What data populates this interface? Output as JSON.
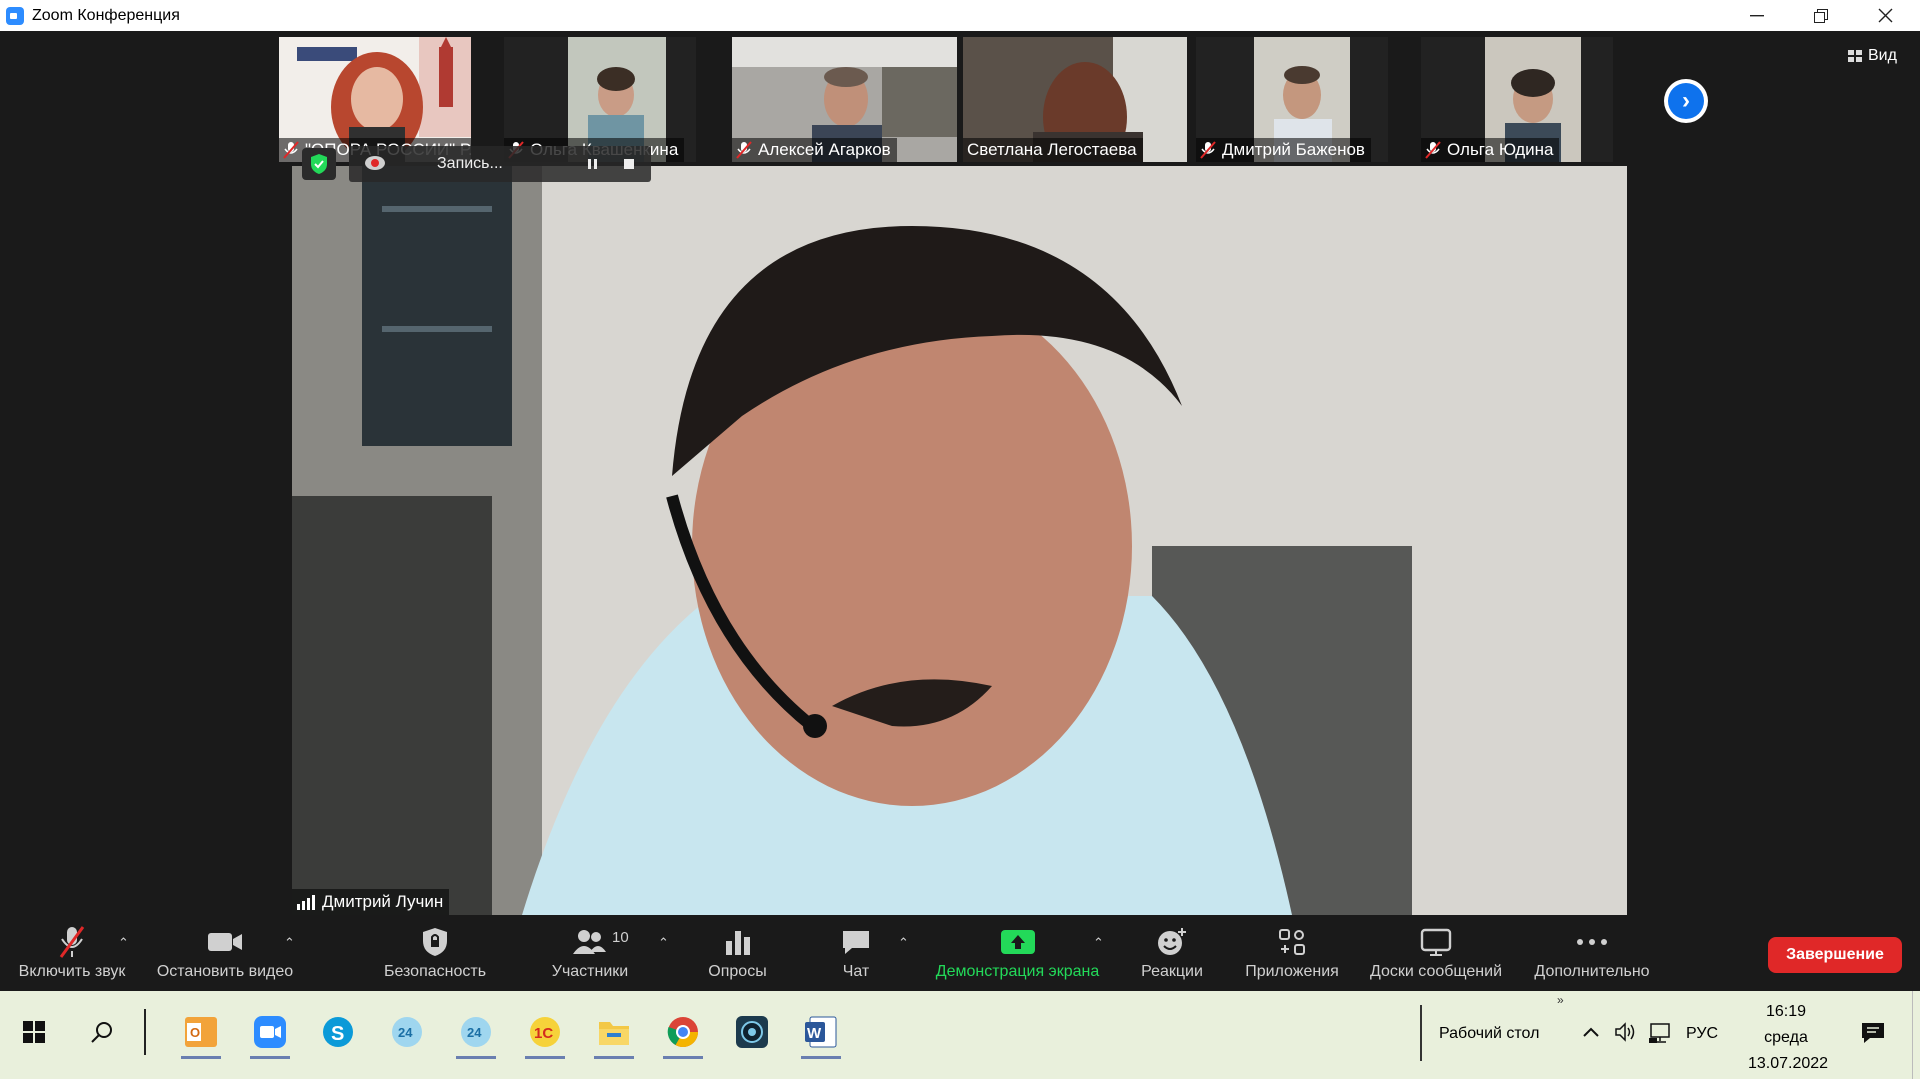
{
  "window": {
    "title": "Zoom Конференция"
  },
  "gallery": [
    {
      "name": "\"ОПОРА РОССИИ\" Р...",
      "muted": true,
      "bg": "#d9dfe8"
    },
    {
      "name": "Ольга Квашенкина",
      "muted": true,
      "bg": "#9aa59c"
    },
    {
      "name": "Алексей Агарков",
      "muted": true,
      "bg": "#8a8d8c"
    },
    {
      "name": "Светлана Легостаева",
      "muted": false,
      "bg": "#6e655e"
    },
    {
      "name": "Дмитрий Баженов",
      "muted": true,
      "bg": "#b9b8ad"
    },
    {
      "name": "Ольга Юдина",
      "muted": true,
      "bg": "#a7a39b"
    }
  ],
  "view_label": "Вид",
  "recording": {
    "label": "Запись..."
  },
  "speaker": {
    "name": "Дмитрий Лучин"
  },
  "toolbar": {
    "audio": "Включить звук",
    "video": "Остановить видео",
    "security": "Безопасность",
    "participants": "Участники",
    "participants_count": "10",
    "polls": "Опросы",
    "chat": "Чат",
    "share": "Демонстрация экрана",
    "reactions": "Реакции",
    "apps": "Приложения",
    "whiteboards": "Доски сообщений",
    "more": "Дополнительно",
    "end": "Завершение"
  },
  "taskbar": {
    "desktop_label": "Рабочий стол",
    "language": "РУС",
    "time": "16:19",
    "weekday": "среда",
    "date": "13.07.2022",
    "apps": [
      "outlook-icon",
      "zoom-icon",
      "skype-icon",
      "bitrix24-icon",
      "bitrix24-icon",
      "1c-icon",
      "file-explorer-icon",
      "chrome-icon",
      "camera-app-icon",
      "word-icon"
    ]
  },
  "colors": {
    "share_green": "#23d959",
    "end_red": "#e02828",
    "zoom_blue": "#0e72ed"
  }
}
